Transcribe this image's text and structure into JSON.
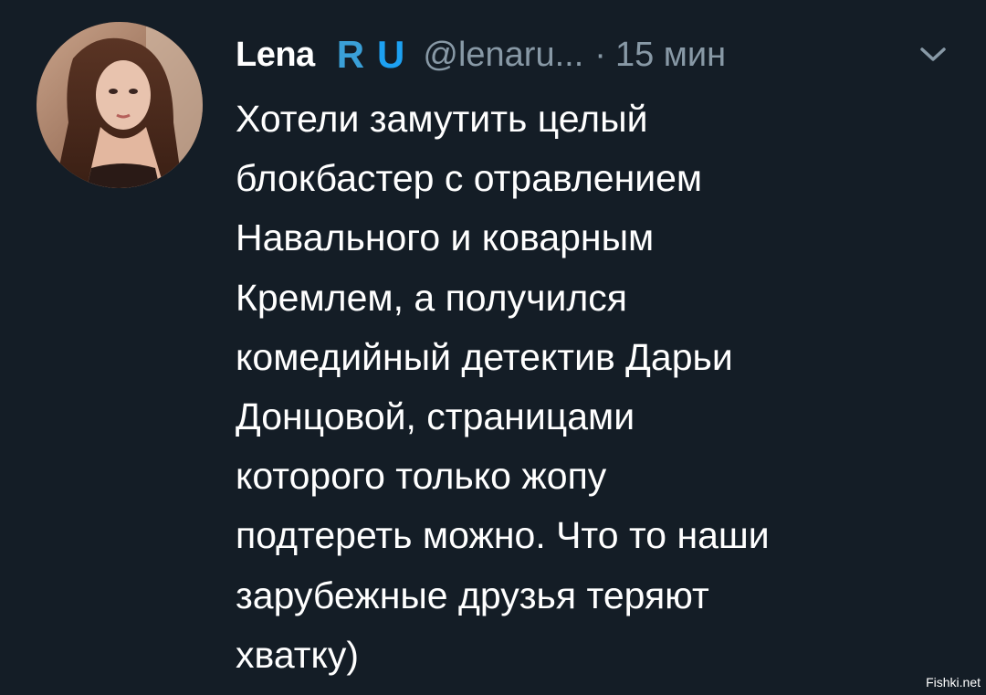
{
  "tweet": {
    "author_name": "Lena",
    "flag_letters": [
      "R",
      "U"
    ],
    "handle": "@lenaru...",
    "separator": "·",
    "time": "15 мин",
    "menu_icon": "chevron-down-icon",
    "body_lines": [
      "Хотели замутить целый",
      "блокбастер с отравлением",
      "Навального и коварным",
      "Кремлем, а получился",
      "комедийный детектив Дарьи",
      "Донцовой, страницами",
      "которого только жопу",
      "подтереть можно. Что то наши",
      "зарубежные друзья теряют",
      "хватку)"
    ]
  },
  "watermark": "Fishki.net",
  "colors": {
    "background": "#141d26",
    "text": "#ffffff",
    "muted": "#8899a6",
    "flag_blue": "#1da1f2"
  }
}
